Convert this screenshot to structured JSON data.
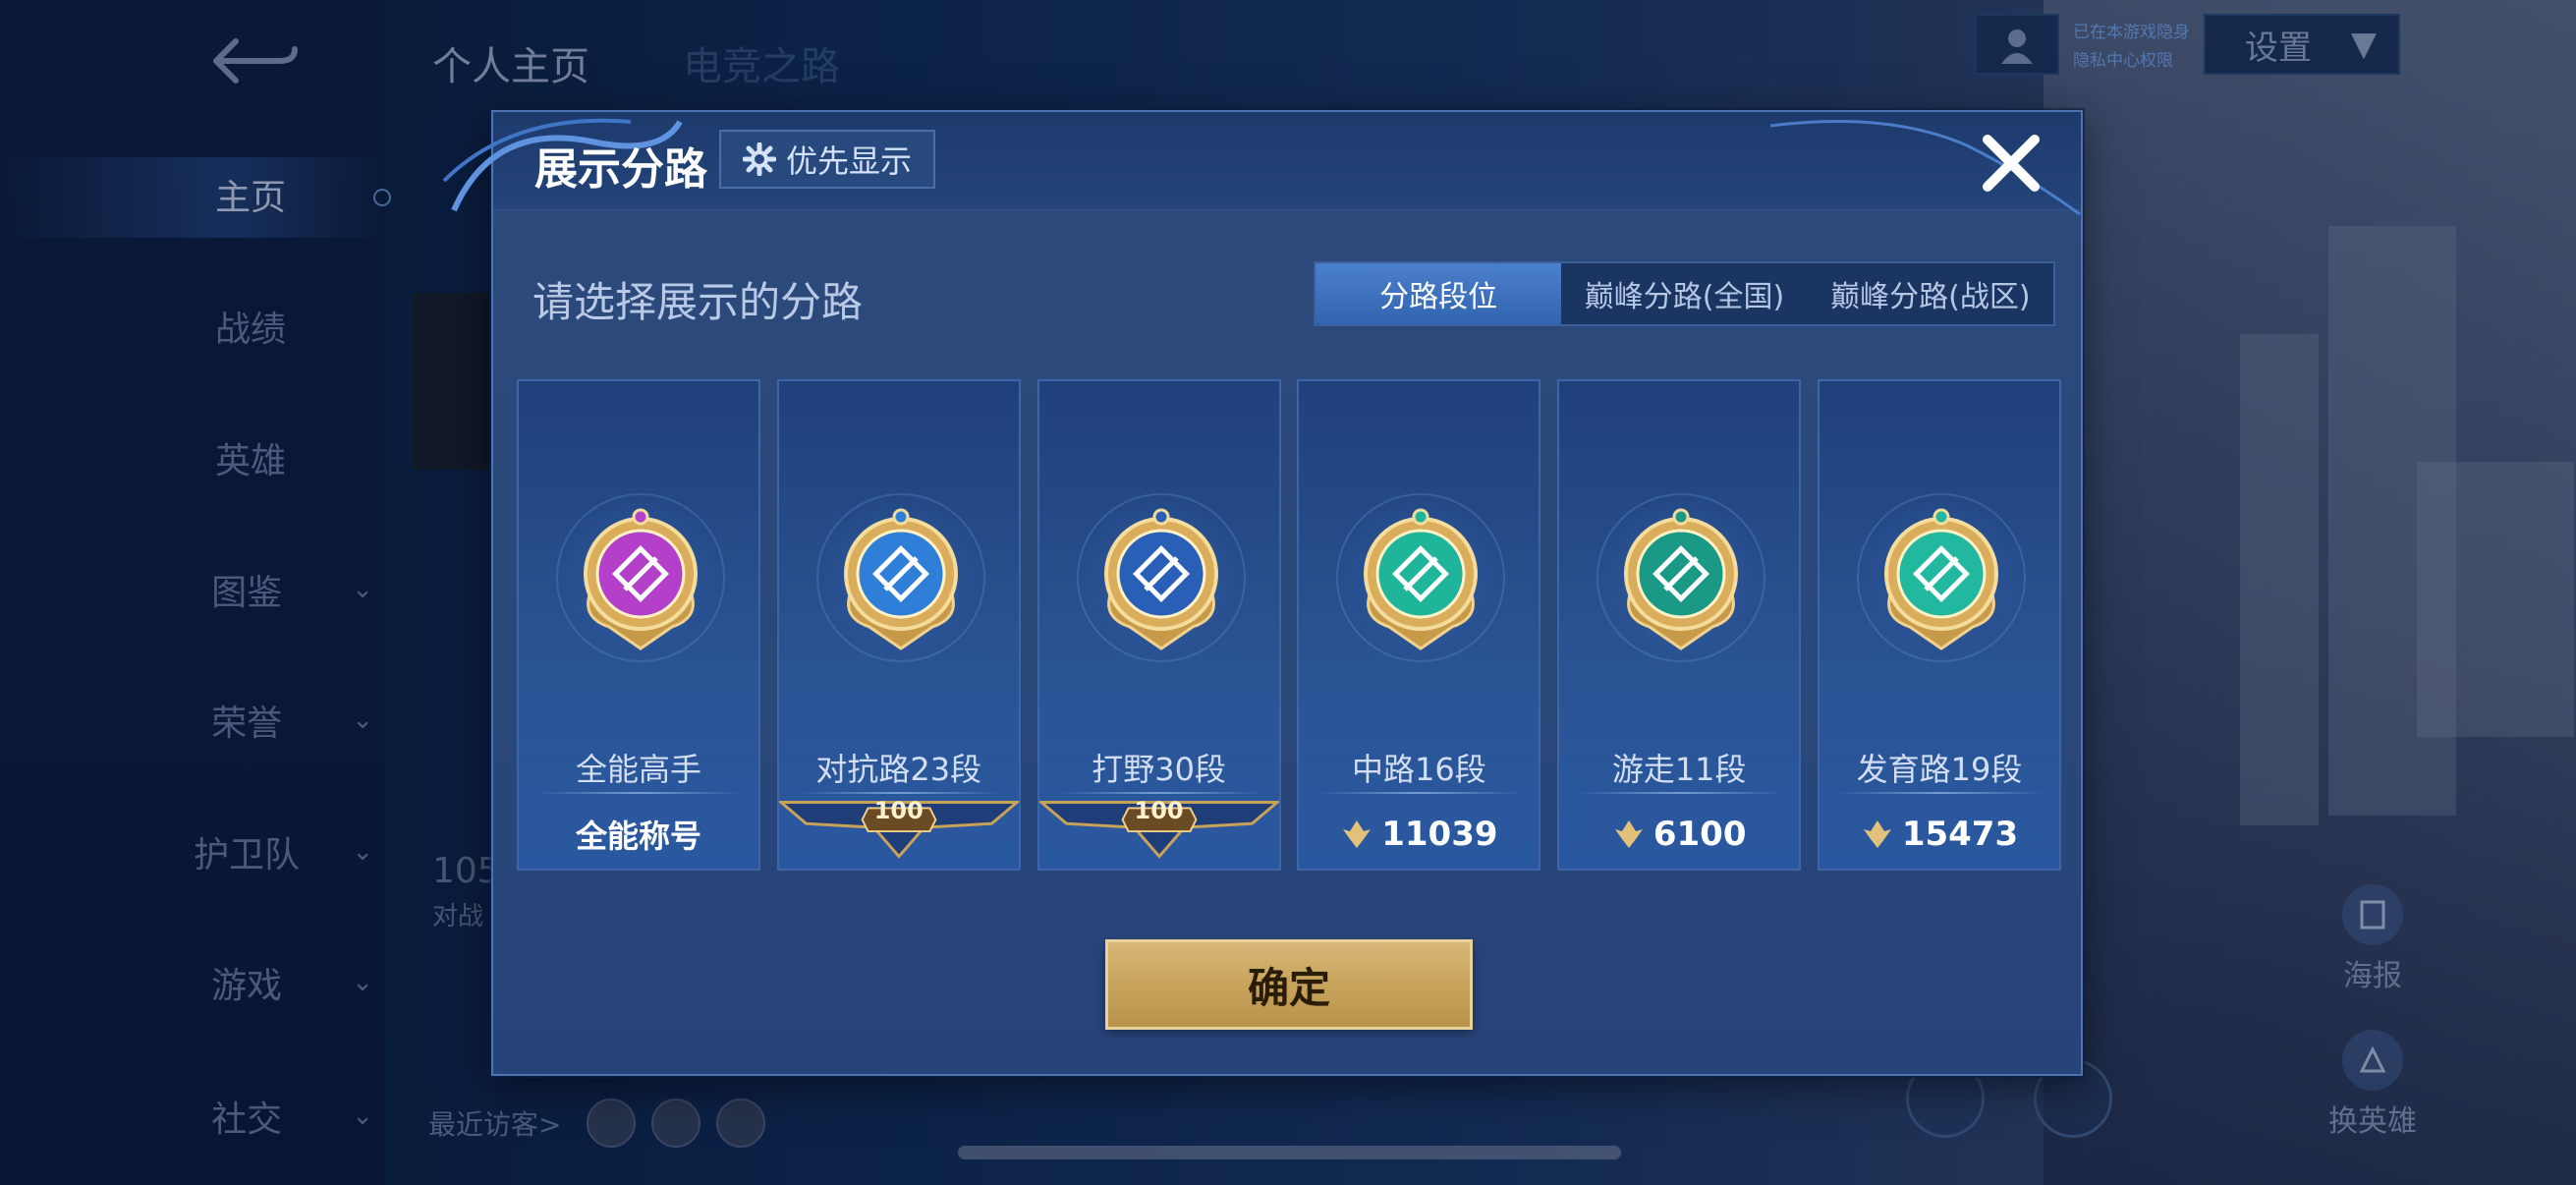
{
  "background": {
    "top_tabs": [
      "个人主页",
      "电竞之路"
    ],
    "nav_items": [
      {
        "label": "主页",
        "chevron": false
      },
      {
        "label": "战绩",
        "chevron": false
      },
      {
        "label": "英雄",
        "chevron": false
      },
      {
        "label": "图鉴",
        "chevron": true
      },
      {
        "label": "荣誉",
        "chevron": true
      },
      {
        "label": "护卫队",
        "chevron": true
      },
      {
        "label": "游戏",
        "chevron": true
      },
      {
        "label": "社交",
        "chevron": true
      }
    ],
    "status_lines": [
      "已在本游戏隐身",
      "隐私中心权限"
    ],
    "settings_label": "设置",
    "stat_partial": "105",
    "stat_partial_sub": "对战",
    "recent_visitors_label": "最近访客>",
    "actions": [
      {
        "label": "海报"
      },
      {
        "label": "换英雄"
      }
    ]
  },
  "modal": {
    "title": "展示分路",
    "priority_label": "优先显示",
    "prompt": "请选择展示的分路",
    "tabs": [
      {
        "label": "分路段位",
        "active": true
      },
      {
        "label": "巅峰分路(全国)",
        "active": false
      },
      {
        "label": "巅峰分路(战区)",
        "active": false
      }
    ],
    "cards": [
      {
        "label": "全能高手",
        "bottom_type": "text",
        "bottom": "全能称号",
        "badge_color": "#b43fc8"
      },
      {
        "label": "对抗路23段",
        "bottom_type": "rank",
        "bottom": "100",
        "badge_color": "#2f7fd8"
      },
      {
        "label": "打野30段",
        "bottom_type": "rank",
        "bottom": "100",
        "badge_color": "#2a5fb8"
      },
      {
        "label": "中路16段",
        "bottom_type": "points",
        "bottom": "11039",
        "badge_color": "#1fb59a"
      },
      {
        "label": "游走11段",
        "bottom_type": "points",
        "bottom": "6100",
        "badge_color": "#1a9a86"
      },
      {
        "label": "发育路19段",
        "bottom_type": "points",
        "bottom": "15473",
        "badge_color": "#22b8a0"
      }
    ],
    "confirm_label": "确定"
  }
}
